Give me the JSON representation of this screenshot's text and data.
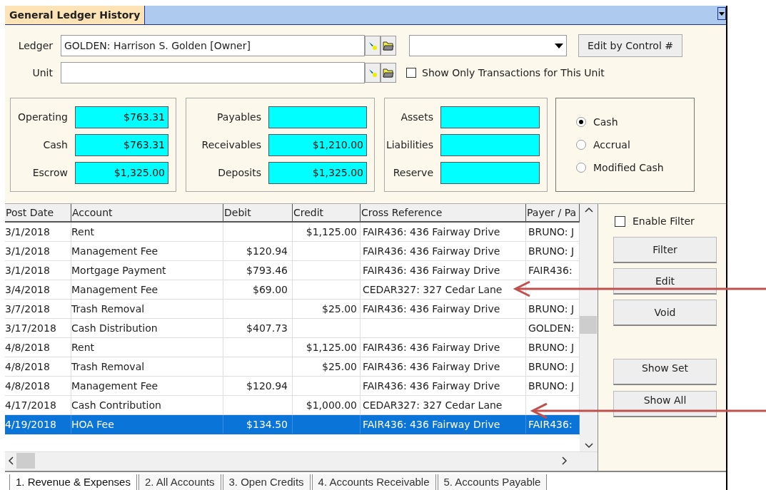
{
  "window": {
    "title": "General Ledger History"
  },
  "ledger": {
    "label": "Ledger",
    "value": "GOLDEN: Harrison S. Golden [Owner]"
  },
  "unit": {
    "label": "Unit",
    "show_only_label": "Show Only Transactions for This Unit",
    "show_only_checked": false
  },
  "edit_by_control_button": "Edit by Control #",
  "balance_groups": [
    [
      {
        "label": "Operating",
        "value": "$763.31"
      },
      {
        "label": "Cash",
        "value": "$763.31"
      },
      {
        "label": "Escrow",
        "value": "$1,325.00"
      }
    ],
    [
      {
        "label": "Payables"
      },
      {
        "label": "Receivables",
        "value": "$1,210.00"
      },
      {
        "label": "Deposits",
        "value": "$1,325.00"
      }
    ],
    [
      {
        "label": "Assets"
      },
      {
        "label": "Liabilities"
      },
      {
        "label": "Reserve"
      }
    ]
  ],
  "basis_options": [
    {
      "label": "Cash",
      "selected": true
    },
    {
      "label": "Accrual",
      "selected": false
    },
    {
      "label": "Modified Cash",
      "selected": false
    }
  ],
  "table": {
    "columns": [
      "Post Date",
      "Account",
      "Debit",
      "Credit",
      "Cross Reference",
      "Payer / Pa"
    ],
    "rows": [
      {
        "cells": [
          "3/1/2018",
          "Rent",
          "",
          "$1,125.00",
          "FAIR436: 436 Fairway Drive",
          "BRUNO: J"
        ],
        "selected": false
      },
      {
        "cells": [
          "3/1/2018",
          "Management Fee",
          "$120.94",
          "",
          "FAIR436: 436 Fairway Drive",
          "BRUNO: J"
        ],
        "selected": false
      },
      {
        "cells": [
          "3/1/2018",
          "Mortgage Payment",
          "$793.46",
          "",
          "FAIR436: 436 Fairway Drive",
          "FAIR436:"
        ],
        "selected": false
      },
      {
        "cells": [
          "3/4/2018",
          "Management Fee",
          "$69.00",
          "",
          "CEDAR327: 327 Cedar Lane",
          ""
        ],
        "selected": false
      },
      {
        "cells": [
          "3/7/2018",
          "Trash Removal",
          "",
          "$25.00",
          "FAIR436: 436 Fairway Drive",
          "BRUNO: J"
        ],
        "selected": false
      },
      {
        "cells": [
          "3/17/2018",
          "Cash Distribution",
          "$407.73",
          "",
          "",
          "GOLDEN:"
        ],
        "selected": false
      },
      {
        "cells": [
          "4/8/2018",
          "Rent",
          "",
          "$1,125.00",
          "FAIR436: 436 Fairway Drive",
          "BRUNO: J"
        ],
        "selected": false
      },
      {
        "cells": [
          "4/8/2018",
          "Trash Removal",
          "",
          "$25.00",
          "FAIR436: 436 Fairway Drive",
          "BRUNO: J"
        ],
        "selected": false
      },
      {
        "cells": [
          "4/8/2018",
          "Management Fee",
          "$120.94",
          "",
          "FAIR436: 436 Fairway Drive",
          "BRUNO: J"
        ],
        "selected": false
      },
      {
        "cells": [
          "4/17/2018",
          "Cash Contribution",
          "",
          "$1,000.00",
          "CEDAR327: 327 Cedar Lane",
          ""
        ],
        "selected": false
      },
      {
        "cells": [
          "4/19/2018",
          "HOA Fee",
          "$134.50",
          "",
          "FAIR436: 436 Fairway Drive",
          "FAIR436:"
        ],
        "selected": true
      }
    ]
  },
  "enable_filter": {
    "label": "Enable Filter",
    "checked": false
  },
  "action_buttons": [
    "Filter",
    "Edit",
    "Void"
  ],
  "set_buttons": [
    "Show Set",
    "Show All"
  ],
  "bottom_tabs": [
    {
      "label": "1. Revenue & Expenses",
      "selected": true
    },
    {
      "label": "2. All Accounts",
      "selected": false
    },
    {
      "label": "3. Open Credits",
      "selected": false
    },
    {
      "label": "4. Accounts Receivable",
      "selected": false
    },
    {
      "label": "5. Accounts Payable",
      "selected": false
    }
  ],
  "callout_arrows": [
    {
      "kind": "arrow"
    },
    {
      "kind": "arrow"
    }
  ]
}
